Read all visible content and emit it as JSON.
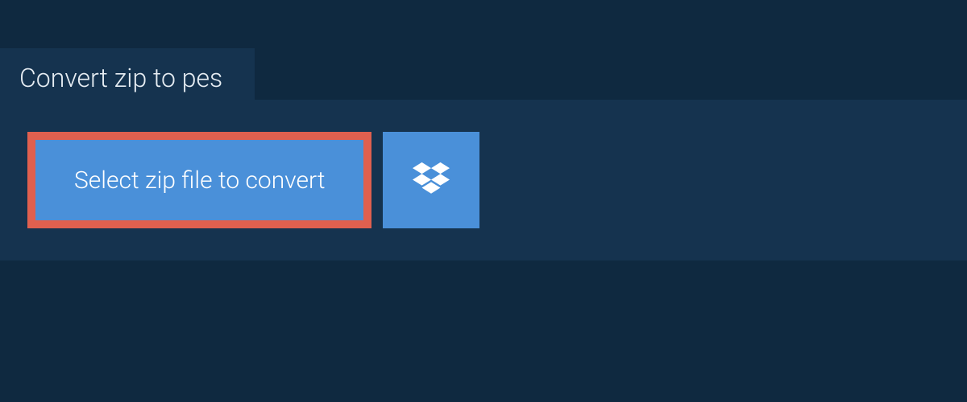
{
  "tab": {
    "title": "Convert zip to pes"
  },
  "actions": {
    "select_file_label": "Select zip file to convert"
  }
}
